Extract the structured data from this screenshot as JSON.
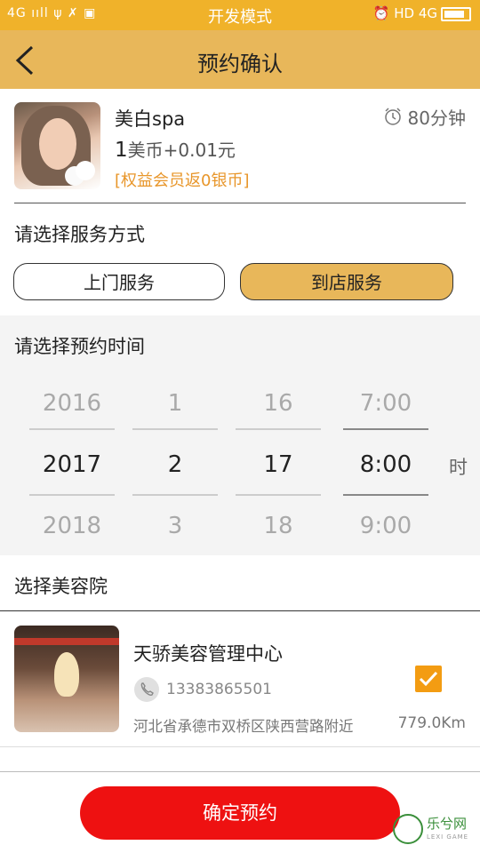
{
  "status_bar": {
    "left": "4G ııll  ψ  ✗  ▣",
    "center": "开发模式",
    "right": "⏰ HD 4G"
  },
  "header": {
    "title": "预约确认"
  },
  "service": {
    "name": "美白spa",
    "price_num": "1",
    "price_rest": "美币+0.01元",
    "member_note": "[权益会员返0银币]",
    "duration": "80分钟"
  },
  "service_mode": {
    "label": "请选择服务方式",
    "options": [
      "上门服务",
      "到店服务"
    ],
    "selected": "到店服务"
  },
  "time_picker": {
    "label": "请选择预约时间",
    "years": [
      "2016",
      "2017",
      "2018"
    ],
    "months": [
      "1",
      "2",
      "3"
    ],
    "days": [
      "16",
      "17",
      "18"
    ],
    "hours": [
      "7:00",
      "8:00",
      "9:00"
    ],
    "unit": "时"
  },
  "salon_section": {
    "label": "选择美容院",
    "salon": {
      "name": "天骄美容管理中心",
      "phone": "13383865501",
      "address": "河北省承德市双桥区陕西营路附近",
      "distance": "779.0Km",
      "checked": true
    }
  },
  "confirm_button": "确定预约",
  "watermark": {
    "text": "乐兮网",
    "sub": "LEXI GAME"
  },
  "colors": {
    "status_bar": "#f0b22a",
    "header": "#e8b75a",
    "accent_orange": "#e8962a",
    "confirm": "#ee1111"
  }
}
